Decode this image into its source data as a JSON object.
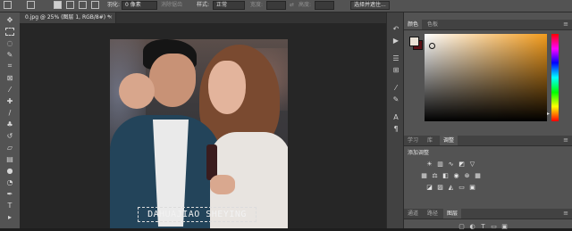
{
  "options_bar": {
    "feather_label": "羽化:",
    "feather_value": "0 像素",
    "antialias_label": "消除锯齿",
    "style_label": "样式:",
    "style_value": "正常",
    "width_label": "宽度:",
    "height_label": "高度:",
    "select_mask_button": "选择并遮住..."
  },
  "document": {
    "tab_title": "0.jpg @ 25% (图层 1, RGB/8#) *",
    "close_glyph": "×"
  },
  "canvas": {
    "watermark_text": "DAHUAJIAO SHEYING"
  },
  "panels": {
    "color": {
      "tabs": [
        "颜色",
        "色板"
      ],
      "foreground_color": "#eae1d6",
      "background_color": "#5a1016"
    },
    "adjustments": {
      "tabs": [
        "学习",
        "库",
        "调整"
      ],
      "add_adjustment_label": "添加调整"
    },
    "layers": {
      "tabs": [
        "通道",
        "路径",
        "图层"
      ]
    }
  },
  "icons": {
    "tools": [
      "move-icon",
      "marquee-icon",
      "lasso-icon",
      "quick-select-icon",
      "crop-icon",
      "frame-icon",
      "eyedropper-icon",
      "healing-brush-icon",
      "brush-icon",
      "clone-stamp-icon",
      "history-brush-icon",
      "eraser-icon",
      "gradient-icon",
      "blur-icon",
      "dodge-icon",
      "pen-icon",
      "type-icon"
    ],
    "panel_strip": [
      "history-icon",
      "actions-icon",
      "properties-icon",
      "brush-settings-icon",
      "character-icon",
      "paragraph-icon"
    ]
  }
}
